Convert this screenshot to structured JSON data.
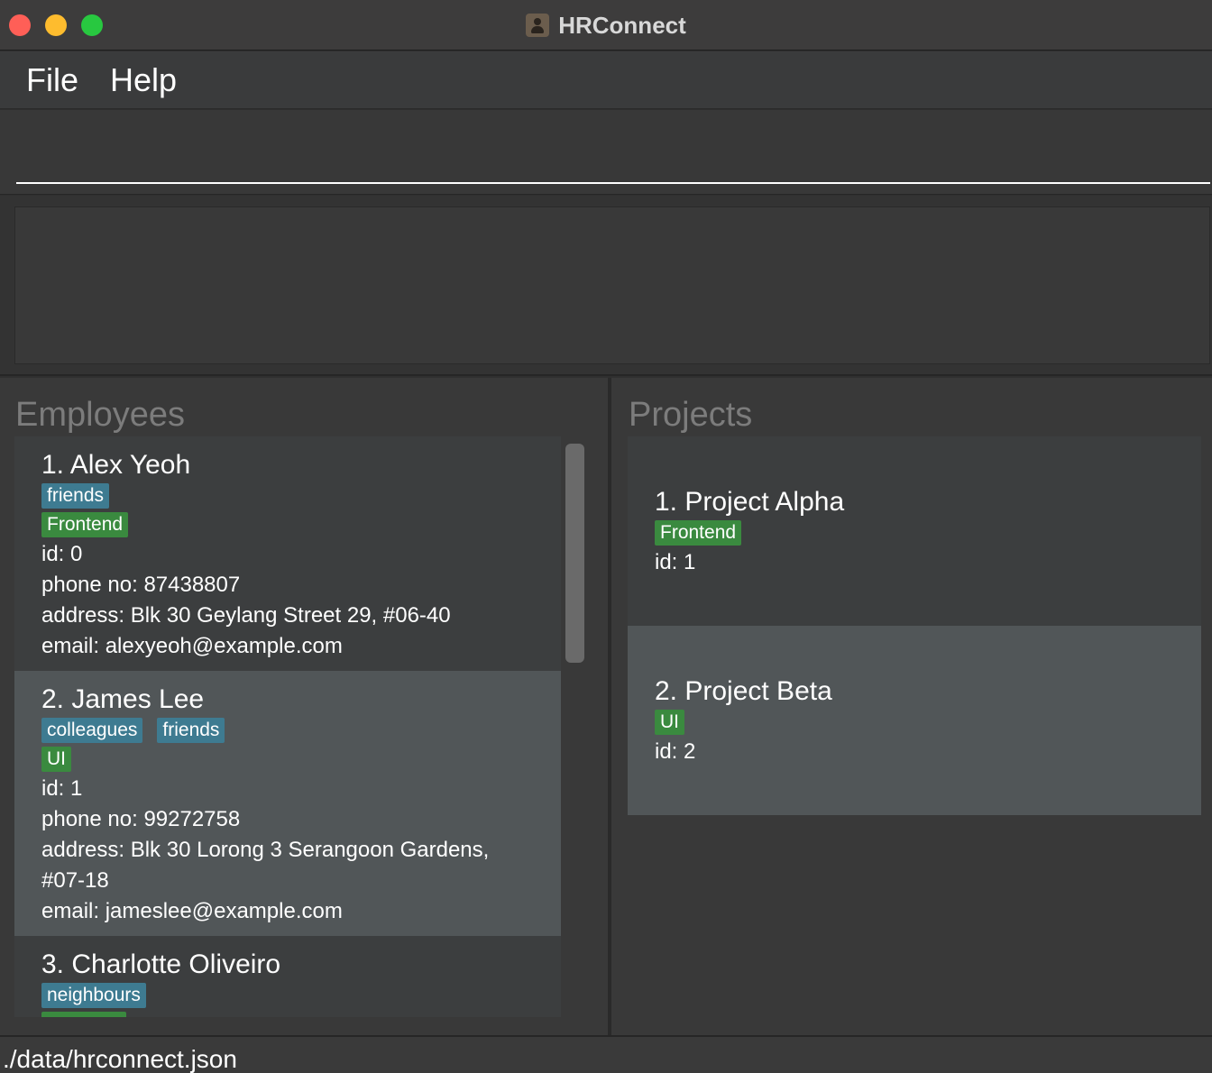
{
  "window": {
    "title": "HRConnect"
  },
  "menu": {
    "file": "File",
    "help": "Help"
  },
  "command": {
    "value": "",
    "placeholder": ""
  },
  "result": {
    "text": ""
  },
  "employees": {
    "title": "Employees",
    "items": [
      {
        "name": "1. Alex Yeoh",
        "tags": [
          "friends"
        ],
        "role": "Frontend",
        "id": "id: 0",
        "phone": "phone no: 87438807",
        "address": "address: Blk 30 Geylang Street 29, #06-40",
        "email": "email: alexyeoh@example.com"
      },
      {
        "name": "2. James Lee",
        "tags": [
          "colleagues",
          "friends"
        ],
        "role": "UI",
        "id": "id: 1",
        "phone": "phone no: 99272758",
        "address_line1": "address: Blk 30 Lorong 3 Serangoon Gardens,",
        "address_line2": "#07-18",
        "email": "email: jameslee@example.com"
      },
      {
        "name": "3. Charlotte Oliveiro",
        "tags": [
          "neighbours"
        ]
      }
    ]
  },
  "projects": {
    "title": "Projects",
    "items": [
      {
        "name": "1. Project Alpha",
        "role": "Frontend",
        "id": "id: 1"
      },
      {
        "name": "2. Project Beta",
        "role": "UI",
        "id": "id: 2"
      }
    ]
  },
  "status": {
    "path": "./data/hrconnect.json"
  },
  "colors": {
    "background": "#2f2f2f",
    "card_dark": "#3c3e3f",
    "card_light": "#515658",
    "tag_blue": "#3e7b91",
    "tag_green": "#3a8a3f"
  }
}
